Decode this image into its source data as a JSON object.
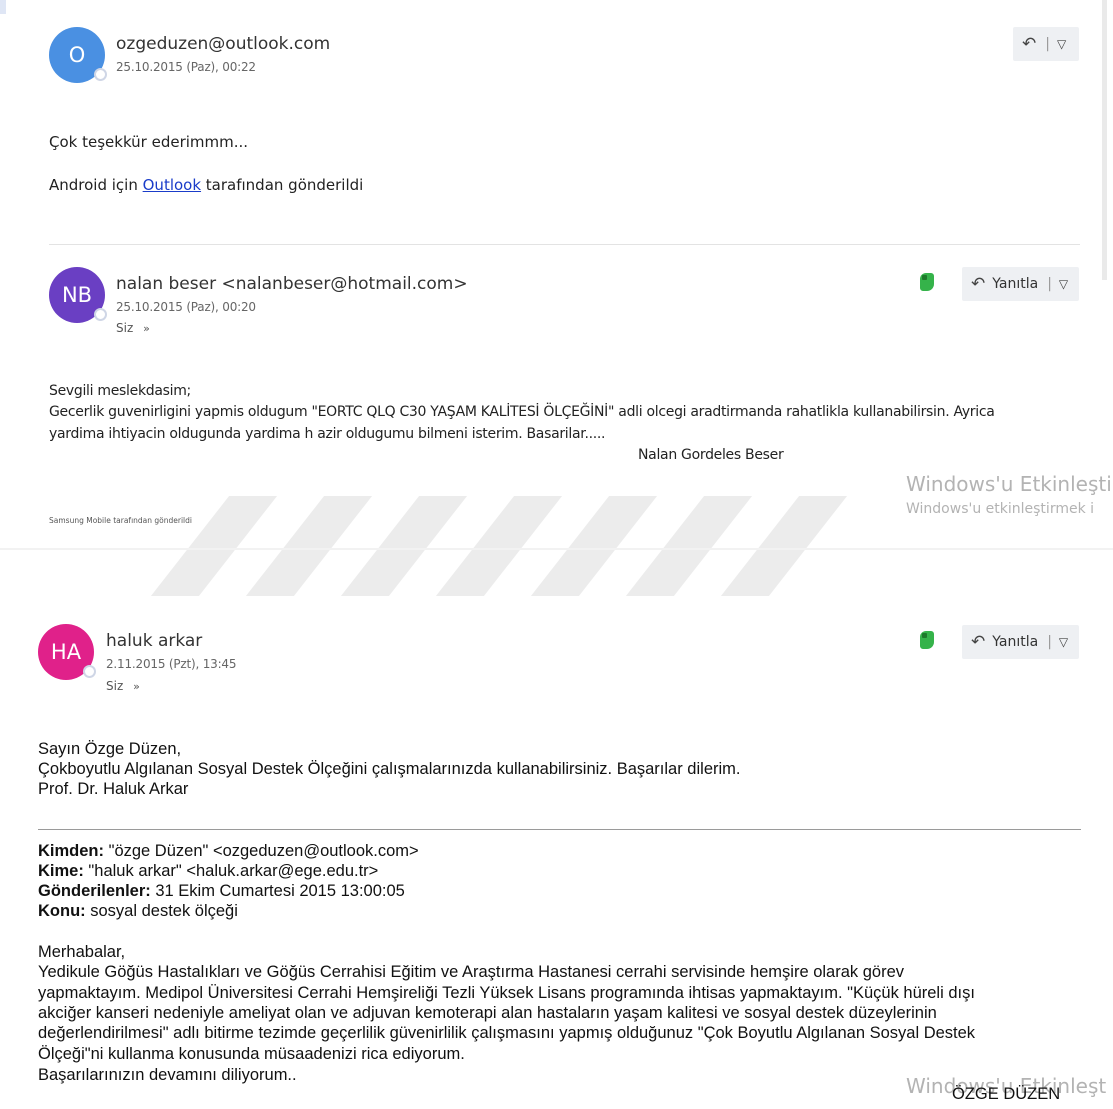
{
  "message1": {
    "avatar_initials": "O",
    "avatar_color": "#4a90e2",
    "sender": "ozgeduzen@outlook.com",
    "date": "25.10.2015 (Paz), 00:22",
    "body_line1": "Çok teşekkür ederimmm...",
    "body_line2_prefix": "Android için ",
    "body_line2_link": "Outlook",
    "body_line2_suffix": " tarafından gönderildi",
    "reply_icon": "reply-icon",
    "dropdown_icon": "chevron-down-icon"
  },
  "message2": {
    "avatar_initials": "NB",
    "avatar_color": "#6a3fc3",
    "sender": "nalan beser <nalanbeser@hotmail.com>",
    "date": "25.10.2015 (Paz), 00:20",
    "to": "Siz",
    "reply_label": "Yanıtla",
    "greeting": "Sevgili meslekdasim;",
    "line1": " Gecerlik guvenirligini yapmis oldugum \"EORTC QLQ C30 YAŞAM KALİTESİ ÖLÇEĞİNİ\" adli olcegi aradtirmanda rahatlikla kullanabilirsin. Ayrica",
    "line2": "yardima ihtiyacin oldugunda yardima h azir oldugumu bilmeni isterim. Basarilar.....",
    "signature": "Nalan Gordeles Beser",
    "footer": "Samsung Mobile tarafından gönderildi"
  },
  "watermark": {
    "line1": "Windows'u Etkinleşti",
    "line2": "Windows'u etkinleştirmek i",
    "bottom": "Windows'u Etkinleşt"
  },
  "message3": {
    "avatar_initials": "HA",
    "avatar_color": "#e0218a",
    "sender": "haluk arkar",
    "date": "2.11.2015 (Pzt), 13:45",
    "to": "Siz",
    "reply_label": "Yanıtla",
    "body_line1": "Sayın Özge Düzen,",
    "body_line2": "Çokboyutlu Algılanan Sosyal Destek Ölçeğini çalışmalarınızda kullanabilirsiniz. Başarılar dilerim.",
    "body_line3": "Prof. Dr. Haluk Arkar"
  },
  "quoted": {
    "from_label": "Kimden:",
    "from_value": " \"özge Düzen\" <ozgeduzen@outlook.com>",
    "to_label": "Kime:",
    "to_value": " \"haluk arkar\" <haluk.arkar@ege.edu.tr>",
    "sent_label": "Gönderilenler:",
    "sent_value": " 31 Ekim Cumartesi 2015 13:00:05",
    "subject_label": "Konu:",
    "subject_value": " sosyal destek ölçeği",
    "greeting": "Merhabalar,",
    "line1": "Yedikule Göğüs Hastalıkları ve Göğüs Cerrahisi Eğitim ve Araştırma Hastanesi cerrahi servisinde hemşire olarak görev",
    "line2": "yapmaktayım. Medipol Üniversitesi Cerrahi Hemşireliği Tezli Yüksek Lisans programında ihtisas yapmaktayım. \"Küçük hüreli dışı",
    "line3": "akciğer kanseri nedeniyle ameliyat olan ve adjuvan kemoterapi alan hastaların yaşam kalitesi ve sosyal destek düzeylerinin",
    "line4": "değerlendirilmesi\"  adlı bitirme tezimde geçerlilik güvenirlilik çalışmasını yapmış olduğunuz \"Çok Boyutlu Algılanan Sosyal Destek",
    "line5": "Ölçeği\"ni kullanma konusunda müsaadenizi rica ediyorum.",
    "line6": "Başarılarınızın devamını diliyorum..",
    "signature": "ÖZGE DÜZEN"
  }
}
